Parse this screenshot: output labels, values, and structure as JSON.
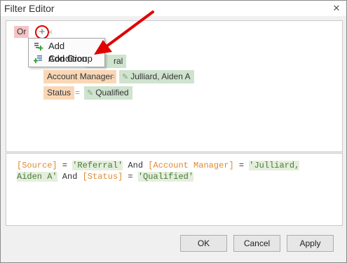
{
  "window": {
    "title": "Filter Editor"
  },
  "filter": {
    "group_operator": "Or",
    "conditions": [
      {
        "field": "Source",
        "operator": "=",
        "value": "Referral"
      },
      {
        "field": "Account Manager",
        "operator": "=",
        "value": "Julliard, Aiden A"
      },
      {
        "field": "Status",
        "operator": "=",
        "value": "Qualified"
      }
    ],
    "visible_value_fragment": "ral"
  },
  "context_menu": {
    "items": [
      {
        "label": "Add Condition",
        "icon": "add-condition-icon"
      },
      {
        "label": "Add Group",
        "icon": "add-group-icon"
      }
    ]
  },
  "expression": {
    "tokens": [
      {
        "t": "[Source]",
        "c": "fld"
      },
      {
        "t": " = ",
        "c": "kw"
      },
      {
        "t": "'Referral'",
        "c": "str"
      },
      {
        "t": " And ",
        "c": "kw"
      },
      {
        "t": "[Account Manager]",
        "c": "fld"
      },
      {
        "t": " = ",
        "c": "kw"
      },
      {
        "t": "'Julliard, Aiden A'",
        "c": "str"
      },
      {
        "t": " And ",
        "c": "kw"
      },
      {
        "t": "[Status]",
        "c": "fld"
      },
      {
        "t": " = ",
        "c": "kw"
      },
      {
        "t": "'Qualified'",
        "c": "str"
      }
    ]
  },
  "buttons": {
    "ok": "OK",
    "cancel": "Cancel",
    "apply": "Apply"
  },
  "colors": {
    "annotation_red": "#e00000",
    "field_chip": "#f9d7b6",
    "value_chip": "#cfe3cf",
    "group_chip": "#f4c4c4"
  }
}
